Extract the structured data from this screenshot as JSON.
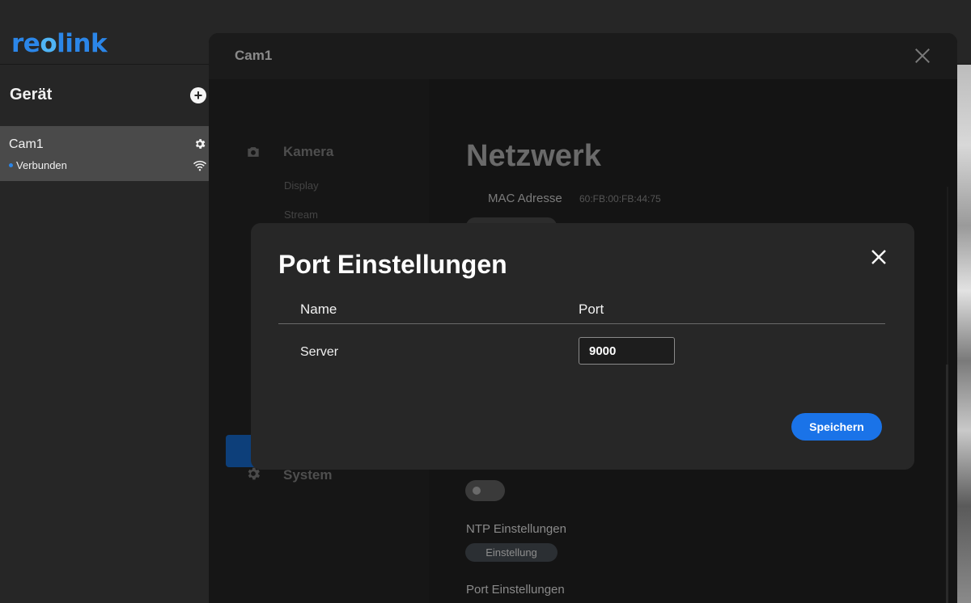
{
  "app": {
    "logo": "reolink"
  },
  "sidebar": {
    "title": "Gerät",
    "add_icon": "plus-circle-icon",
    "devices": [
      {
        "name": "Cam1",
        "status": "Verbunden",
        "status_color": "#2b86e8"
      }
    ]
  },
  "settings_panel": {
    "title": "Cam1",
    "nav": {
      "camera_heading": "Kamera",
      "camera_items": [
        "Display",
        "Stream"
      ],
      "system_heading": "System"
    },
    "content": {
      "title": "Netzwerk",
      "mac_label": "MAC Adresse",
      "mac_value": "60:FB:00:FB:44:75",
      "ntp_label": "NTP Einstellungen",
      "ntp_button": "Einstellung",
      "port_label": "Port Einstellungen"
    }
  },
  "modal": {
    "title": "Port Einstellungen",
    "columns": {
      "name": "Name",
      "port": "Port"
    },
    "rows": [
      {
        "name": "Server",
        "port": "9000"
      }
    ],
    "save_label": "Speichern",
    "accent_color": "#1a73e8"
  }
}
